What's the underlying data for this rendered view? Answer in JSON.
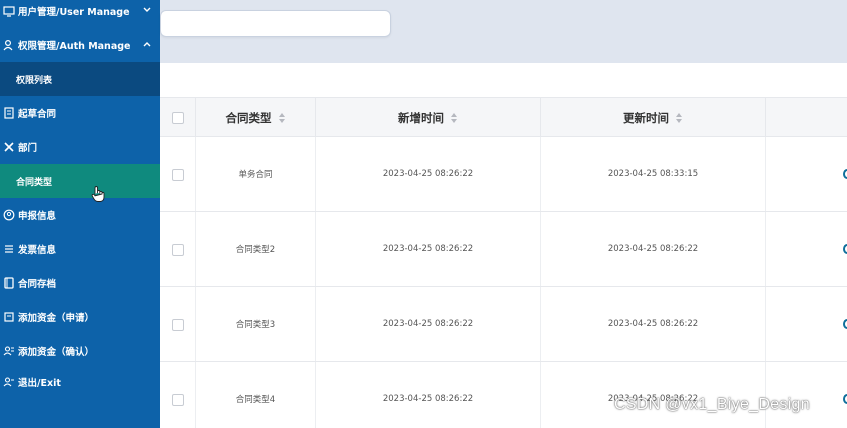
{
  "sidebar": {
    "items": [
      {
        "label": "用户管理/User Manage",
        "icon": "monitor-icon"
      },
      {
        "label": "权限管理/Auth Manage",
        "icon": "user-key-icon"
      },
      {
        "label": "权限列表"
      },
      {
        "label": "起草合同",
        "icon": "document-icon"
      },
      {
        "label": "部门",
        "icon": "cross-icon"
      },
      {
        "label": "合同类型"
      },
      {
        "label": "申报信息",
        "icon": "person-circle-icon"
      },
      {
        "label": "发票信息",
        "icon": "list-icon"
      },
      {
        "label": "合同存档",
        "icon": "book-icon"
      },
      {
        "label": "添加资金（申请）",
        "icon": "note-icon"
      },
      {
        "label": "添加资金（确认）",
        "icon": "users-icon"
      },
      {
        "label": "退出/Exit",
        "icon": "user-exit-icon"
      }
    ]
  },
  "table": {
    "headers": [
      "合同类型",
      "新增时间",
      "更新时间"
    ],
    "rows": [
      {
        "type": "单务合同",
        "created": "2023-04-25 08:26:22",
        "updated": "2023-04-25 08:33:15"
      },
      {
        "type": "合同类型2",
        "created": "2023-04-25 08:26:22",
        "updated": "2023-04-25 08:26:22"
      },
      {
        "type": "合同类型3",
        "created": "2023-04-25 08:26:22",
        "updated": "2023-04-25 08:26:22"
      },
      {
        "type": "合同类型4",
        "created": "2023-04-25 08:26:22",
        "updated": "2023-04-25 08:26:22"
      }
    ]
  },
  "watermark": "CSDN @vx1_Biye_Design",
  "colors": {
    "sidebar": "#0d62a9",
    "sidebar_dark": "#0b4a80",
    "active": "#0f8a7e",
    "header_bg": "#dfe5ef"
  }
}
